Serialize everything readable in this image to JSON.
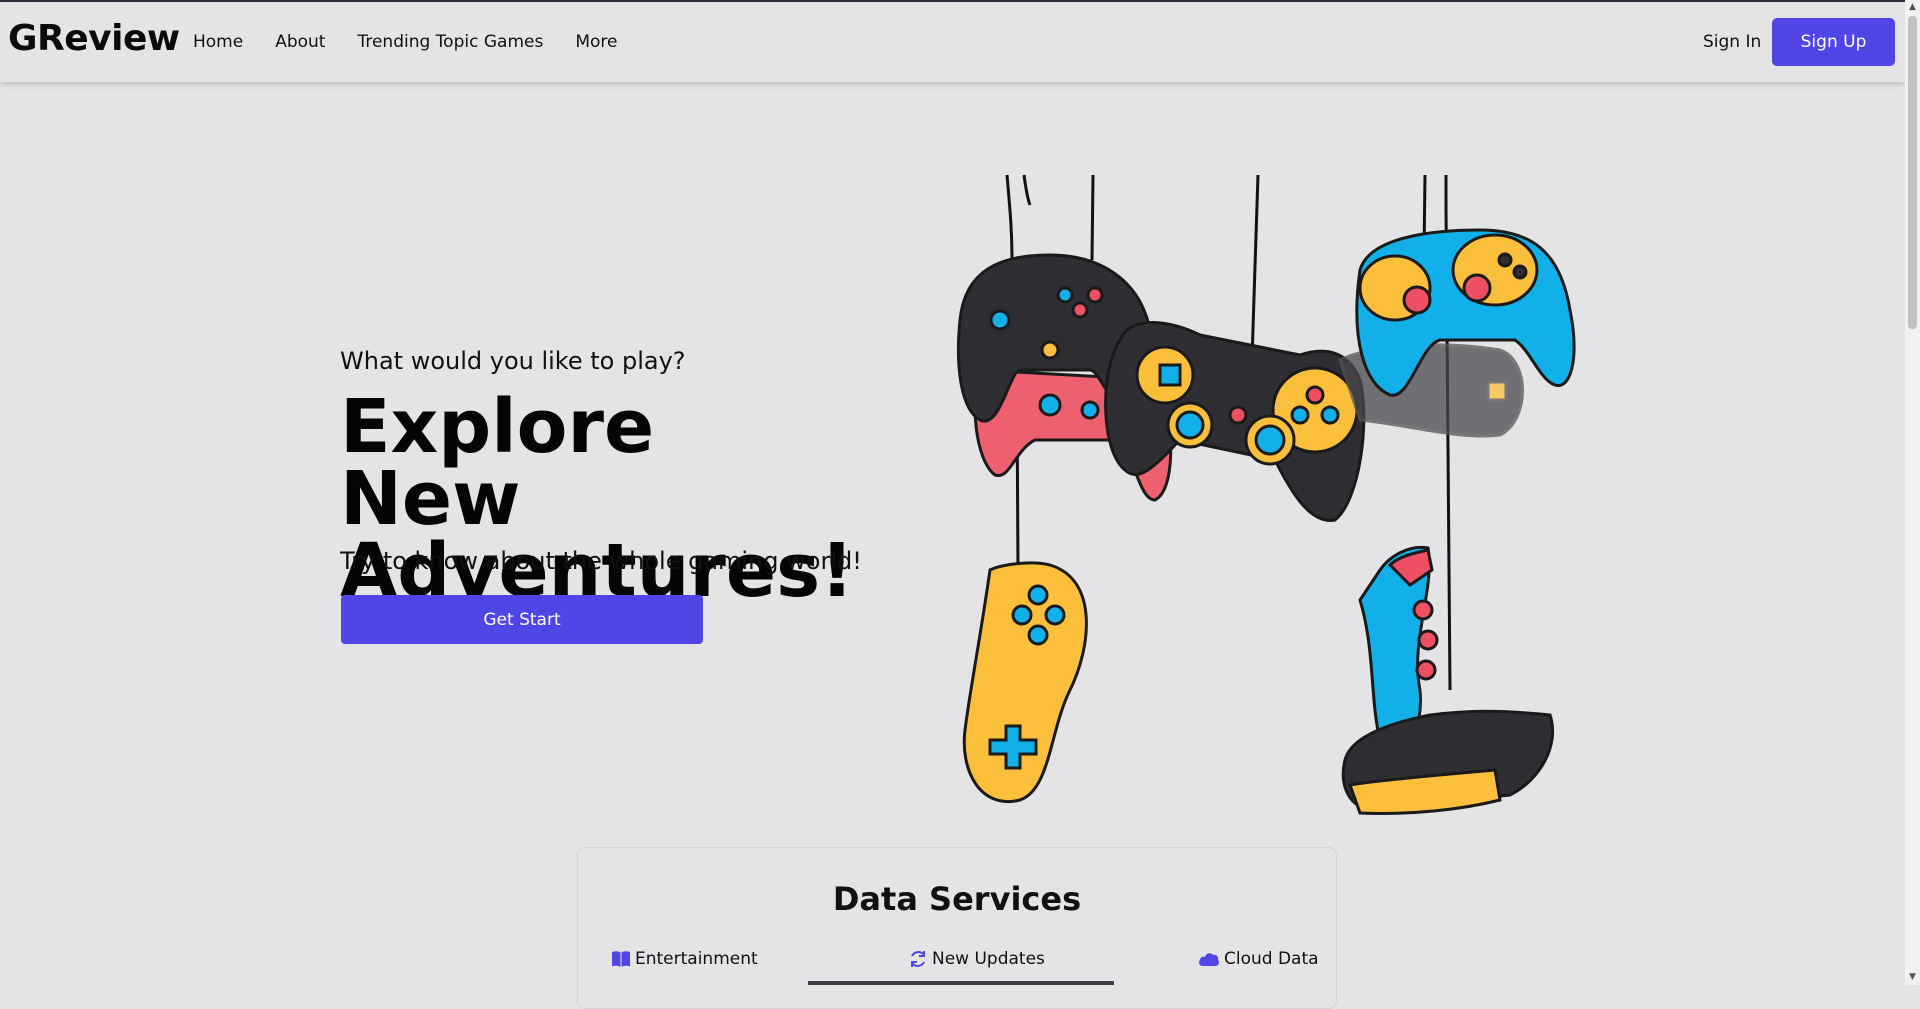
{
  "header": {
    "brand": "GReview",
    "nav": [
      "Home",
      "About",
      "Trending Topic Games",
      "More"
    ],
    "sign_in": "Sign In",
    "sign_up": "Sign Up"
  },
  "hero": {
    "subtitle": "What would you like to play?",
    "title_line1": "Explore New",
    "title_line2": "Adventures!",
    "description": "Try to know about the whole gaming world!",
    "cta": "Get Start"
  },
  "services": {
    "title": "Data Services",
    "tabs": [
      {
        "label": "Entertainment",
        "icon": "book-icon"
      },
      {
        "label": "New Updates",
        "icon": "refresh-icon"
      },
      {
        "label": "Cloud Data",
        "icon": "cloud-icon"
      }
    ],
    "active_tab": "New Updates"
  },
  "colors": {
    "accent": "#4f46e5",
    "background": "#e4e4e7",
    "controller_yellow": "#fbbf3c",
    "controller_blue": "#12b0e8",
    "controller_black": "#2f2f33",
    "controller_red": "#ee4f63"
  }
}
